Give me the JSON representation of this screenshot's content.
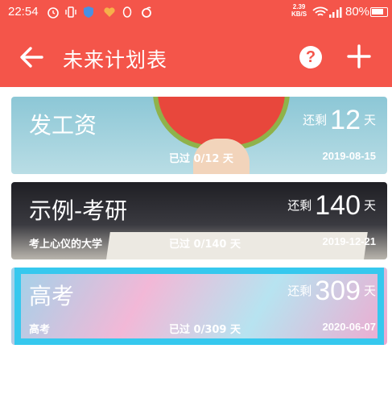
{
  "status_bar": {
    "time": "22:54",
    "net_speed": "2.39",
    "net_unit": "KB/S",
    "battery": "80%"
  },
  "app_bar": {
    "title": "未来计划表",
    "help_label": "?"
  },
  "cards": [
    {
      "name": "发工资",
      "remain_label": "还剩",
      "days_left": "12",
      "unit": "天",
      "note": "",
      "passed": "已过 0/12 天",
      "date": "2019-08-15"
    },
    {
      "name": "示例-考研",
      "remain_label": "还剩",
      "days_left": "140",
      "unit": "天",
      "note": "考上心仪的大学",
      "passed": "已过 0/140 天",
      "date": "2019-12-21"
    },
    {
      "name": "高考",
      "remain_label": "还剩",
      "days_left": "309",
      "unit": "天",
      "note": "高考",
      "passed": "已过 0/309 天",
      "date": "2020-06-07"
    }
  ],
  "colors": {
    "primary": "#f4554a",
    "selection": "#36c8ee"
  }
}
